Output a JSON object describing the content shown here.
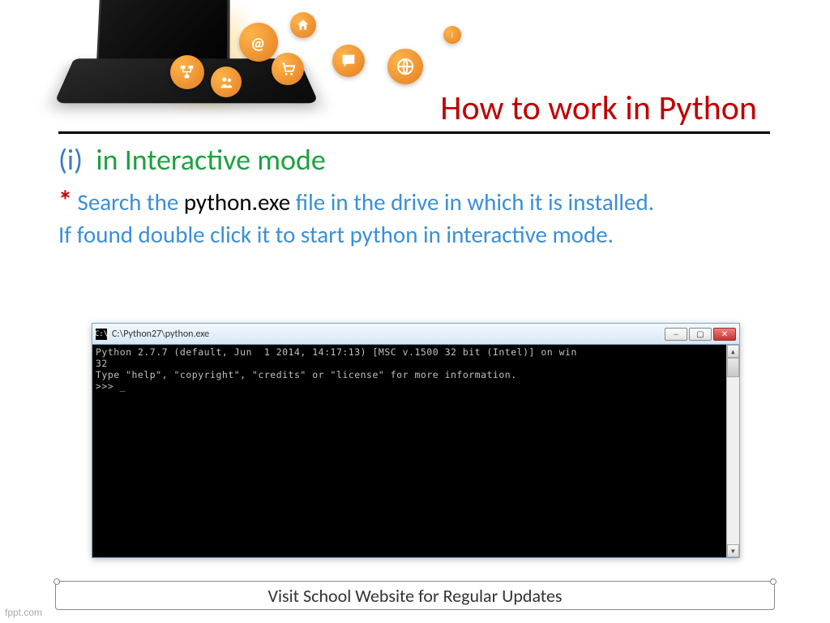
{
  "title": "How to work in Python",
  "subhead": {
    "paren_open": "(i)",
    "green_text": "in Interactive mode"
  },
  "body": {
    "asterisk": "*",
    "line1a": "Search the ",
    "line1b": "python.exe",
    "line1c": " file in the drive in which it is installed.",
    "line2": "If found double click it to start python in interactive mode."
  },
  "console": {
    "title": "C:\\Python27\\python.exe",
    "output": "Python 2.7.7 (default, Jun  1 2014, 14:17:13) [MSC v.1500 32 bit (Intel)] on win\n32\nType \"help\", \"copyright\", \"credits\" or \"license\" for more information.\n>>> _"
  },
  "footer": "Visit School Website for Regular Updates",
  "watermark": "fppt.com"
}
